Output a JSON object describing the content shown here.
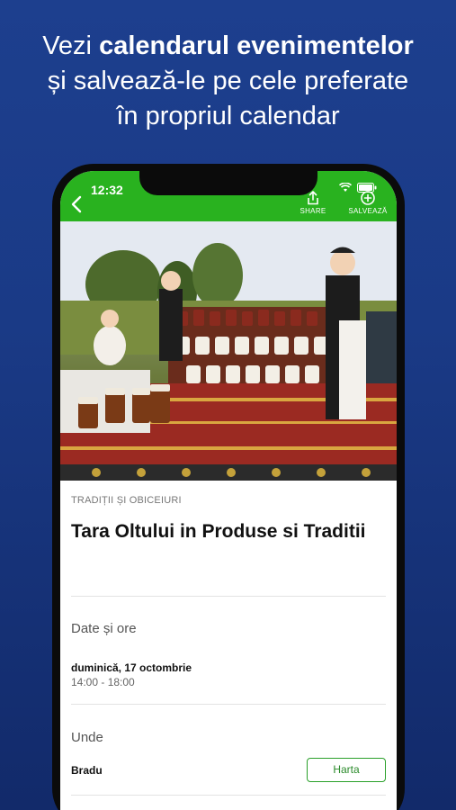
{
  "promo": {
    "line1_plain": "Vezi ",
    "line1_bold": "calendarul evenimentelor",
    "line2": "și salvează-le pe cele preferate",
    "line3": "în propriul calendar"
  },
  "status_bar": {
    "time": "12:32"
  },
  "app_bar": {
    "share_label": "SHARE",
    "save_label": "SALVEAZĂ"
  },
  "event": {
    "category": "TRADIȚII ȘI OBICEIURI",
    "title": "Tara Oltului in Produse si Traditii",
    "dates_label": "Date și ore",
    "date": "duminică, 17 octombrie",
    "hours": "14:00 - 18:00",
    "where_label": "Unde",
    "place": "Bradu",
    "map_button": "Harta"
  },
  "colors": {
    "background": "#1a3a86",
    "app_bar": "#29b21f",
    "map_button_border": "#2aa02a"
  },
  "icons": [
    "back-arrow-icon",
    "wifi-icon",
    "battery-icon",
    "share-icon",
    "calendar-add-icon"
  ]
}
